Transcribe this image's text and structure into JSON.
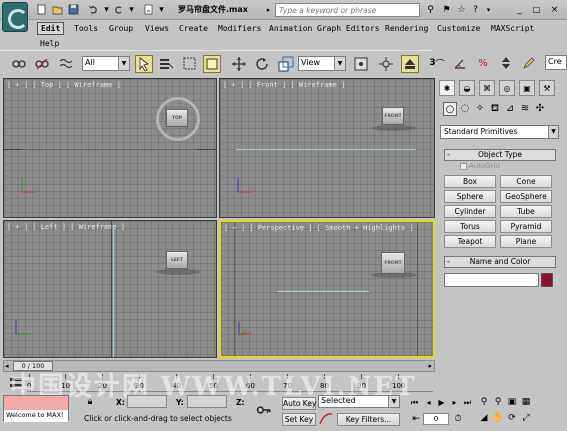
{
  "titlebar": {
    "title": "罗马帘盘文件.max",
    "search_placeholder": "Type a keyword or phrase"
  },
  "menu": {
    "items": [
      "Edit",
      "Tools",
      "Group",
      "Views",
      "Create",
      "Modifiers",
      "Animation",
      "Graph Editors",
      "Rendering",
      "Customize",
      "MAXScript",
      "Help"
    ],
    "active": "Edit"
  },
  "toolbar": {
    "selection_filter": "All",
    "ref_coord": "View",
    "search_stub": "Cre"
  },
  "viewports": [
    {
      "label": "[ + ] [ Top ] [ Wireframe ]",
      "cube_label": "TOP",
      "active": false
    },
    {
      "label": "[ + ] [ Front ] [ Wireframe ]",
      "cube_label": "FRONT",
      "active": false
    },
    {
      "label": "[ + ] [ Left ] [ Wireframe ]",
      "cube_label": "LEFT",
      "active": false
    },
    {
      "label": "[ + ] [ Perspective ] [ Smooth + Highlights ]",
      "cube_label": "FRONT",
      "active": true
    }
  ],
  "command_panel": {
    "category": "Standard Primitives",
    "object_type_title": "Object Type",
    "autogrid_label": "AutoGrid",
    "primitives": [
      "Box",
      "Cone",
      "Sphere",
      "GeoSphere",
      "Cylinder",
      "Tube",
      "Torus",
      "Pyramid",
      "Teapot",
      "Plane"
    ],
    "name_color_title": "Name and Color",
    "name_value": "",
    "object_color": "#8c1133"
  },
  "timeline": {
    "slider_label": "0 / 100",
    "ticks": [
      "0",
      "10",
      "20",
      "30",
      "40",
      "50",
      "60",
      "70",
      "80",
      "90",
      "100"
    ],
    "watermark": "中国设计网 WWW.TLVI.NET"
  },
  "status": {
    "maxscript_text": "Welcome to MAX!",
    "x_label": "X:",
    "y_label": "Y:",
    "z_label": "Z:",
    "prompt": "Click or click-and-drag to select objects",
    "auto_key": "Auto Key",
    "set_key": "Set Key",
    "selected": "Selected",
    "key_filters": "Key Filters...",
    "frame": "0"
  },
  "colors": {
    "active_viewport_border": "#e4d81a",
    "viewport_bg": "#8c8c8c",
    "maxscript_bg": "#f0a8a8"
  }
}
